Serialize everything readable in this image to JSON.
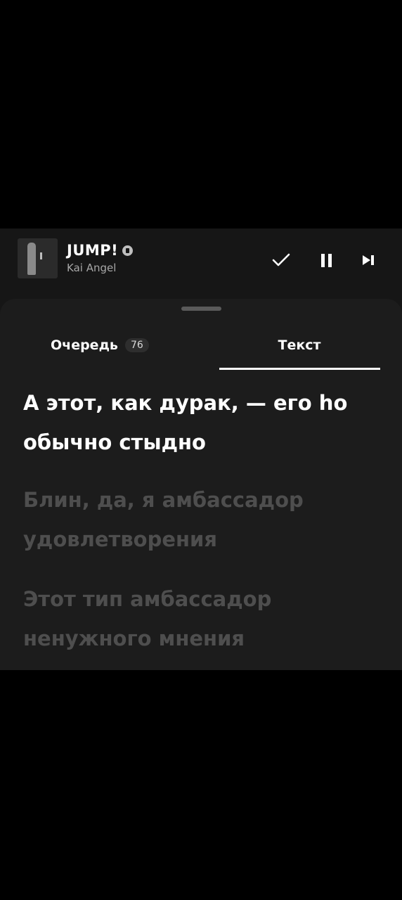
{
  "now_playing": {
    "title": "JUMP!",
    "artist": "Kai Angel"
  },
  "controls": {
    "added_icon": "checkmark-icon",
    "pause_icon": "pause-icon",
    "next_icon": "skip-next-icon"
  },
  "tabs": {
    "queue_label": "Очередь",
    "queue_count": "76",
    "lyrics_label": "Текст"
  },
  "lyrics": [
    "А этот, как дурак, — его hо обычно стыдно",
    "Блин, да, я амбассадор удовлетворения",
    "Этот тип амбассадор ненужного мнения"
  ],
  "colors": {
    "background": "#000000",
    "player_bg": "#161616",
    "sheet_bg": "#1c1c1c",
    "active_lyric": "#ffffff",
    "inactive_lyric": "#4e4e4e"
  }
}
